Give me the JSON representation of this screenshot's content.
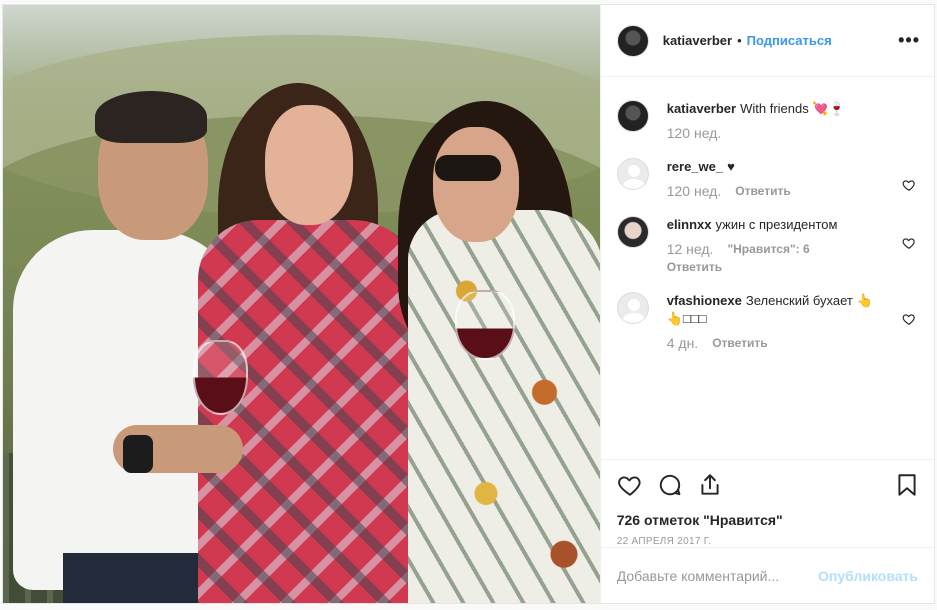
{
  "post": {
    "author": "katiaverber",
    "follow_label": "Подписаться",
    "separator": "•",
    "more_label": "•••"
  },
  "caption": {
    "user": "katiaverber",
    "text": "With friends 💘🍷",
    "time": "120 нед."
  },
  "comments": [
    {
      "user": "rere_we_",
      "text": "♥",
      "time": "120 нед.",
      "reply": "Ответить",
      "likes": ""
    },
    {
      "user": "elinnxx",
      "text": "ужин с президентом",
      "time": "12 нед.",
      "likes": "\"Нравится\": 6",
      "reply": "Ответить"
    },
    {
      "user": "vfashionexe",
      "text": "Зеленский бухает 👆 👆□□□",
      "time": "4 дн.",
      "reply": "Ответить",
      "likes": ""
    }
  ],
  "actions": {
    "likes_text": "726 отметок \"Нравится\"",
    "date": "22 АПРЕЛЯ 2017 Г."
  },
  "add_comment": {
    "placeholder": "Добавьте комментарий...",
    "publish_label": "Опубликовать"
  },
  "colors": {
    "accent": "#3897f0",
    "publish_disabled": "#b2dffc",
    "muted": "#999999"
  }
}
